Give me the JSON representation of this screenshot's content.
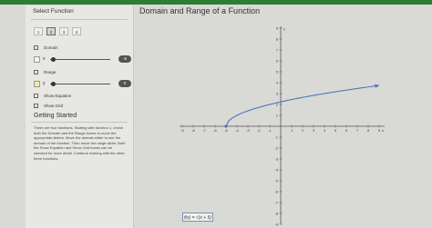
{
  "app": {
    "sidebar_title": "Select Function",
    "main_title": "Domain and Range of a Function"
  },
  "function_buttons": [
    {
      "label": "1",
      "selected": false
    },
    {
      "label": "2",
      "selected": true
    },
    {
      "label": "3",
      "selected": false
    },
    {
      "label": "4",
      "selected": false
    }
  ],
  "domain": {
    "checkbox_label": "Domain",
    "checked": true,
    "variable": "x",
    "value": "-5",
    "slider_level": 0.06
  },
  "range": {
    "checkbox_label": "Range",
    "checked": true,
    "variable": "y",
    "value": "0",
    "slider_level": 0.06
  },
  "options": {
    "show_equation_label": "Show Equation",
    "show_equation_checked": true,
    "show_grid_label": "Show Grid",
    "show_grid_checked": true
  },
  "getting_started": {
    "title": "Getting Started",
    "body": "There are four functions. Starting with function 1, check both the Domain and the Range boxes to move the appropriate sliders. Move the domain slider to see the domain of the function. Then move the range slider. Both the Show Equation and Show Grid boxes can be checked for more detail. Continue working with the other three functions."
  },
  "equation": {
    "text": "f(x) = √(x + 5)"
  },
  "chart_data": {
    "type": "line",
    "xlim": [
      -9,
      9
    ],
    "ylim": [
      -9,
      9
    ],
    "x_ticks": [
      -9,
      -8,
      -7,
      -6,
      -5,
      -4,
      -3,
      -2,
      -1,
      1,
      2,
      3,
      4,
      5,
      6,
      7,
      8,
      9
    ],
    "y_ticks": [
      9,
      8,
      7,
      6,
      5,
      4,
      3,
      2,
      1,
      -1,
      -2,
      -3,
      -4,
      -5,
      -6,
      -7,
      -8,
      -9
    ],
    "x_axis_label": "x",
    "y_axis_label": "y",
    "grid": false,
    "curve": {
      "name": "f(x) = √(x + 5)",
      "start": [
        -5,
        0
      ],
      "x_end": 9,
      "color": "#4a78b5"
    },
    "domain_start_marker": {
      "x": -5,
      "y": 0
    },
    "axis_color": "#555555"
  }
}
